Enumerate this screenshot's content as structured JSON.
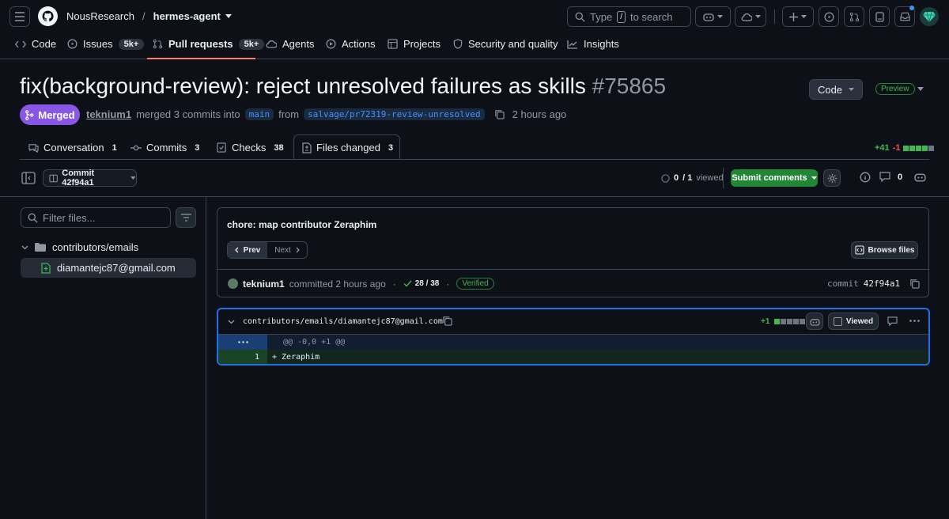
{
  "header": {
    "owner": "NousResearch",
    "separator": "/",
    "repo": "hermes-agent",
    "search_prefix": "Type",
    "search_key": "/",
    "search_suffix": "to search"
  },
  "repo_nav": {
    "items": [
      {
        "label": "Code"
      },
      {
        "label": "Issues",
        "count": "5k+"
      },
      {
        "label": "Pull requests",
        "count": "5k+"
      },
      {
        "label": "Agents"
      },
      {
        "label": "Actions"
      },
      {
        "label": "Projects"
      },
      {
        "label": "Security and quality"
      },
      {
        "label": "Insights"
      }
    ]
  },
  "pr": {
    "title": "fix(background-review): reject unresolved failures as skills",
    "number": "#75865",
    "code_button": "Code",
    "preview_label": "Preview",
    "state": "Merged",
    "author": "teknium1",
    "merge_text": "merged 3 commits into",
    "base_branch": "main",
    "from_text": "from",
    "head_branch": "salvage/pr72319-review-unresolved",
    "time": "2 hours ago"
  },
  "pr_tabs": [
    {
      "label": "Conversation",
      "count": "1"
    },
    {
      "label": "Commits",
      "count": "3"
    },
    {
      "label": "Checks",
      "count": "38"
    },
    {
      "label": "Files changed",
      "count": "3"
    }
  ],
  "diffstat": {
    "additions": "+41",
    "deletions": "-1"
  },
  "toolbar": {
    "commit_select": "Commit 42f94a1",
    "viewed_done": "0",
    "viewed_total": "/ 1",
    "viewed_label": "viewed",
    "submit_label": "Submit comments",
    "comment_count": "0"
  },
  "sidebar": {
    "filter_placeholder": "Filter files...",
    "dir": "contributors/emails",
    "file": "diamantejc87@gmail.com"
  },
  "commit": {
    "message": "chore: map contributor Zeraphim",
    "prev_label": "Prev",
    "next_label": "Next",
    "browse_label": "Browse files",
    "author": "teknium1",
    "committed_text": "committed 2 hours ago",
    "dot": "·",
    "checks": "28 / 38",
    "verified": "Verified",
    "sha_label": "commit",
    "sha": "42f94a1"
  },
  "diff": {
    "path": "contributors/emails/diamantejc87@gmail.com",
    "additions": "+1",
    "viewed_label": "Viewed",
    "hunk_header": "@@ -0,0 +1 @@",
    "line_number": "1",
    "line_text": "+ Zeraphim"
  },
  "colors": {
    "background": "#0d1117",
    "border": "#3d444d",
    "merged": "#8957e5",
    "success": "#238636",
    "accent_blue": "#1f6feb",
    "active_tab_underline": "#f78166"
  }
}
